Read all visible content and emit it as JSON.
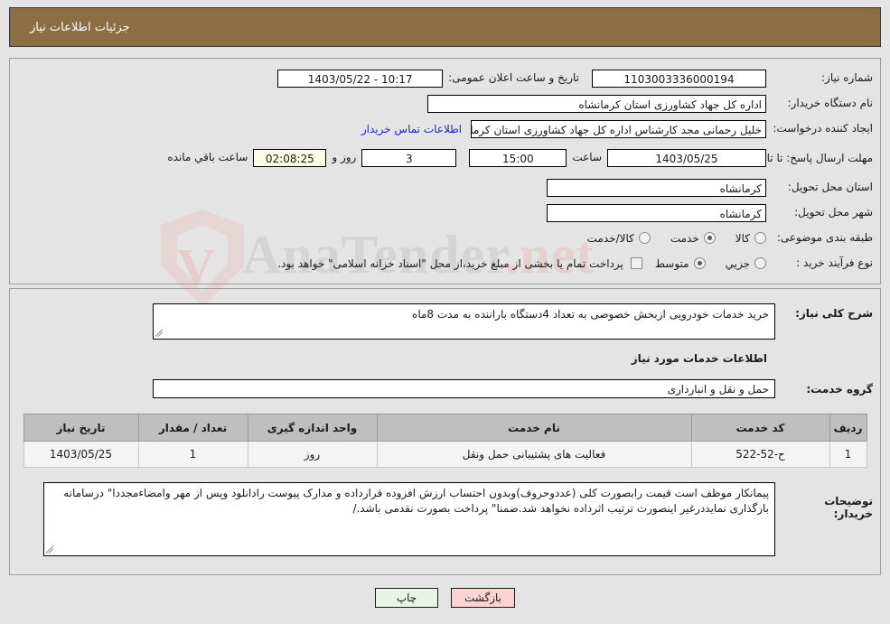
{
  "header": {
    "title": "جزئیات اطلاعات نیاز"
  },
  "watermark": {
    "brand": "AnaTender",
    "tld": ".net",
    "letter": "V"
  },
  "form": {
    "need_number": {
      "label": "شماره نیاز:",
      "value": "1103003336000194"
    },
    "public_announce": {
      "label": "تاریخ و ساعت اعلان عمومی:",
      "value": "10:17 - 1403/05/22"
    },
    "buyer_org": {
      "label": "نام دستگاه خریدار:",
      "value": "اداره کل جهاد کشاورزی استان کرمانشاه"
    },
    "creator": {
      "label": "ایجاد کننده درخواست:",
      "value": "خلیل رحمانی مجد کارشناس اداره کل جهاد کشاورزی استان کرمانشاه"
    },
    "buyer_contact_link": "اطلاعات تماس خریدار",
    "deadline": {
      "label": "مهلت ارسال پاسخ: تا تاریخ:",
      "date": "1403/05/25",
      "time_label": "ساعت",
      "time": "15:00",
      "days": "3",
      "days_label": "روز و",
      "remaining": "02:08:25",
      "remaining_label": "ساعت باقي مانده"
    },
    "delivery_province": {
      "label": "استان محل تحویل:",
      "value": "کرمانشاه"
    },
    "delivery_city": {
      "label": "شهر محل تحویل:",
      "value": "کرمانشاه"
    },
    "category": {
      "label": "طبقه بندی موضوعی:",
      "options": [
        "کالا",
        "خدمت",
        "کالا/خدمت"
      ],
      "selected": "خدمت"
    },
    "purchase_process": {
      "label": "نوع فرآیند خرید :",
      "options": [
        "جزیي",
        "متوسط"
      ],
      "selected": "متوسط",
      "checkbox_label": "پرداخت تمام یا بخشی از مبلغ خرید،از محل \"اسناد خزانه اسلامی\" خواهد بود.",
      "checkbox_checked": false
    }
  },
  "body": {
    "description": {
      "label": "شرح کلی نیاز:",
      "value": "خرید خدمات خودرویی ازبخش خصوصی به تعداد 4دستگاه باراننده به مدت 8ماه"
    },
    "services_section_title": "اطلاعات خدمات مورد نیاز",
    "service_group": {
      "label": "گروه خدمت:",
      "value": "حمل و نقل و انبارداری"
    },
    "table": {
      "columns": [
        "ردیف",
        "کد خدمت",
        "نام خدمت",
        "واحد اندازه گیری",
        "تعداد / مقدار",
        "تاریخ نیاز"
      ],
      "rows": [
        {
          "radif": "1",
          "code": "ح-52-522",
          "name": "فعالیت های پشتیبانی حمل ونقل",
          "unit": "روز",
          "qty": "1",
          "date": "1403/05/25"
        }
      ]
    },
    "buyer_notes": {
      "label": "توضیحات خریدار:",
      "value": "پیمانکار موظف است قیمت رابصورت کلی (عددوحروف)وبدون احتساب ارزش افزوده قرارداده و مدارک پیوست رادانلود وپس از مهر وامضاءمجددا\" درسامانه بارگذاری نمایددرغیر اینصورت ترتیب اثرداده نخواهد شد.ضمنا\" پرداخت بصورت نقدمی باشد./"
    }
  },
  "footer": {
    "print_label": "چاپ",
    "back_label": "بازگشت"
  },
  "colors": {
    "header_bar": "#8d6e43",
    "page_bg": "#e4e4e4",
    "link": "#2424d0",
    "table_header": "#bfbfbf",
    "print_button": "#e7f5e4",
    "back_button": "#fbd3d3",
    "countdown_field": "#fbfbe8"
  }
}
